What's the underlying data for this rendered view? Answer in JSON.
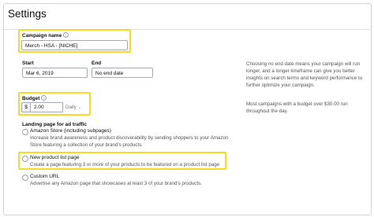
{
  "page": {
    "title": "Settings"
  },
  "campaign": {
    "label": "Campaign name",
    "value": "Merch - HSA - [NICHE]"
  },
  "start": {
    "label": "Start",
    "value": "Mar 6, 2019"
  },
  "end": {
    "label": "End",
    "value": "No end date"
  },
  "dates_help": "Choosing no end date means your campaign will run longer, and a longer timeframe can give you better insights on search terms and keyword performance to further optimize your campaign.",
  "budget": {
    "label": "Budget",
    "currency": "$",
    "value": "2.00",
    "frequency": "Daily",
    "help": "Most campaigns with a budget over $30.00 run throughout the day."
  },
  "landing": {
    "label": "Landing page for ad traffic",
    "options": [
      {
        "label": "Amazon Store (including subpages)",
        "desc": "Increase brand awareness and product discoverability by sending shoppers to your Amazon Store featuring a collection of your brand's products."
      },
      {
        "label": "New product list page",
        "desc": "Create a page featuring 3 or more of your products to be featured on a product list page"
      },
      {
        "label": "Custom URL",
        "desc": "Advertise any Amazon page that showcases at least 3 of your brand's products."
      }
    ]
  },
  "colors": {
    "highlight": "#f5dc24",
    "border": "#a6abb1"
  }
}
